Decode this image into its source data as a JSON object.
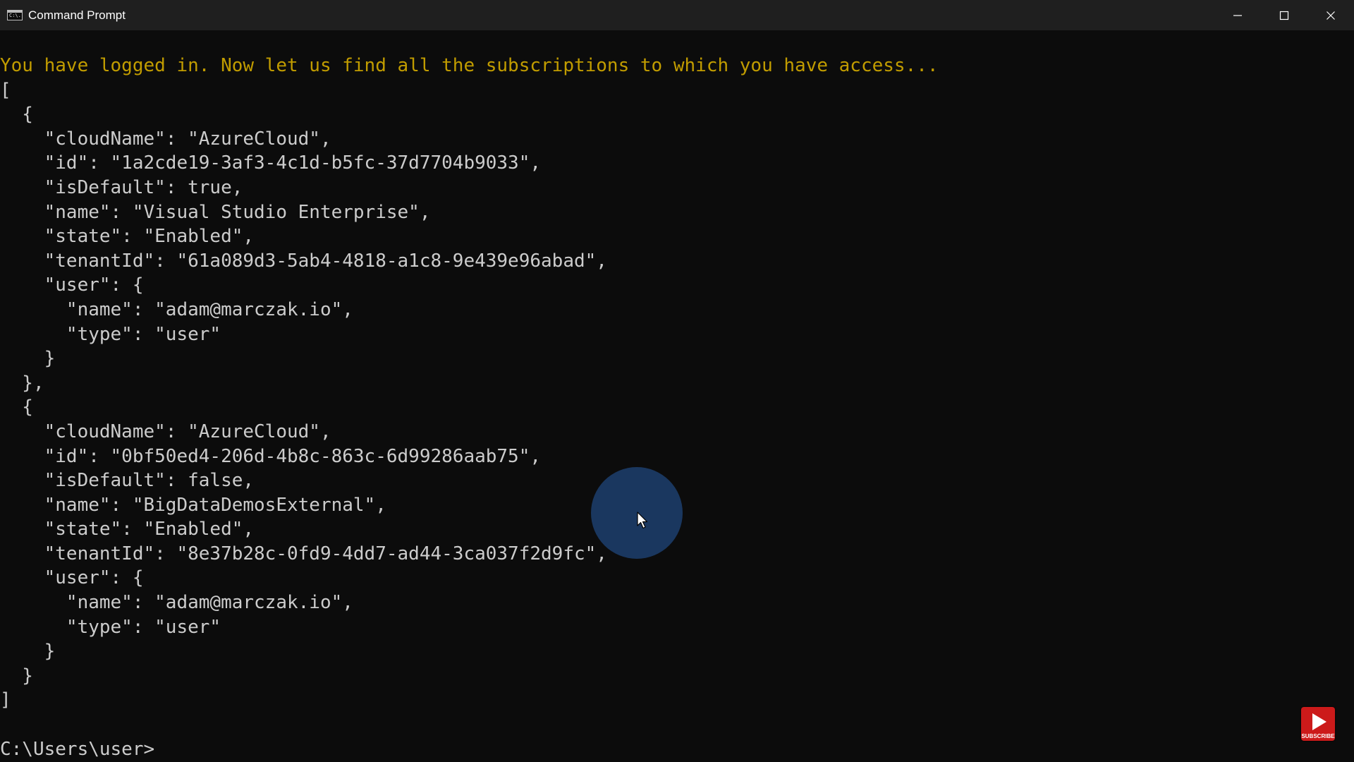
{
  "window": {
    "title": "Command Prompt",
    "icon": "cmd-icon",
    "icon_text": "C:\\.",
    "controls": [
      "minimize-icon",
      "maximize-icon",
      "close-icon"
    ]
  },
  "console": {
    "lines": [
      {
        "text": "You have logged in. Now let us find all the subscriptions to which you have access...",
        "color": "#c19c00"
      },
      {
        "text": "["
      },
      {
        "text": "  {"
      },
      {
        "text": "    \"cloudName\": \"AzureCloud\","
      },
      {
        "text": "    \"id\": \"1a2cde19-3af3-4c1d-b5fc-37d7704b9033\","
      },
      {
        "text": "    \"isDefault\": true,"
      },
      {
        "text": "    \"name\": \"Visual Studio Enterprise\","
      },
      {
        "text": "    \"state\": \"Enabled\","
      },
      {
        "text": "    \"tenantId\": \"61a089d3-5ab4-4818-a1c8-9e439e96abad\","
      },
      {
        "text": "    \"user\": {"
      },
      {
        "text": "      \"name\": \"adam@marczak.io\","
      },
      {
        "text": "      \"type\": \"user\""
      },
      {
        "text": "    }"
      },
      {
        "text": "  },"
      },
      {
        "text": "  {"
      },
      {
        "text": "    \"cloudName\": \"AzureCloud\","
      },
      {
        "text": "    \"id\": \"0bf50ed4-206d-4b8c-863c-6d99286aab75\","
      },
      {
        "text": "    \"isDefault\": false,"
      },
      {
        "text": "    \"name\": \"BigDataDemosExternal\","
      },
      {
        "text": "    \"state\": \"Enabled\","
      },
      {
        "text": "    \"tenantId\": \"8e37b28c-0fd9-4dd7-ad44-3ca037f2d9fc\","
      },
      {
        "text": "    \"user\": {"
      },
      {
        "text": "      \"name\": \"adam@marczak.io\","
      },
      {
        "text": "      \"type\": \"user\""
      },
      {
        "text": "    }"
      },
      {
        "text": "  }"
      },
      {
        "text": "]"
      },
      {
        "text": ""
      },
      {
        "text": "C:\\Users\\user>"
      }
    ]
  },
  "overlay": {
    "subscribe_label": "SUBSCRIBE",
    "subscribe_icon": "play-icon",
    "pointer_icon": "mouse-pointer-icon"
  },
  "colors": {
    "background": "#0c0c0c",
    "titlebar": "#1f1f1f",
    "text": "#cccccc",
    "highlight": "#c19c00",
    "cursor_halo": "#1b3a64",
    "subscribe": "#cc1a1a"
  }
}
